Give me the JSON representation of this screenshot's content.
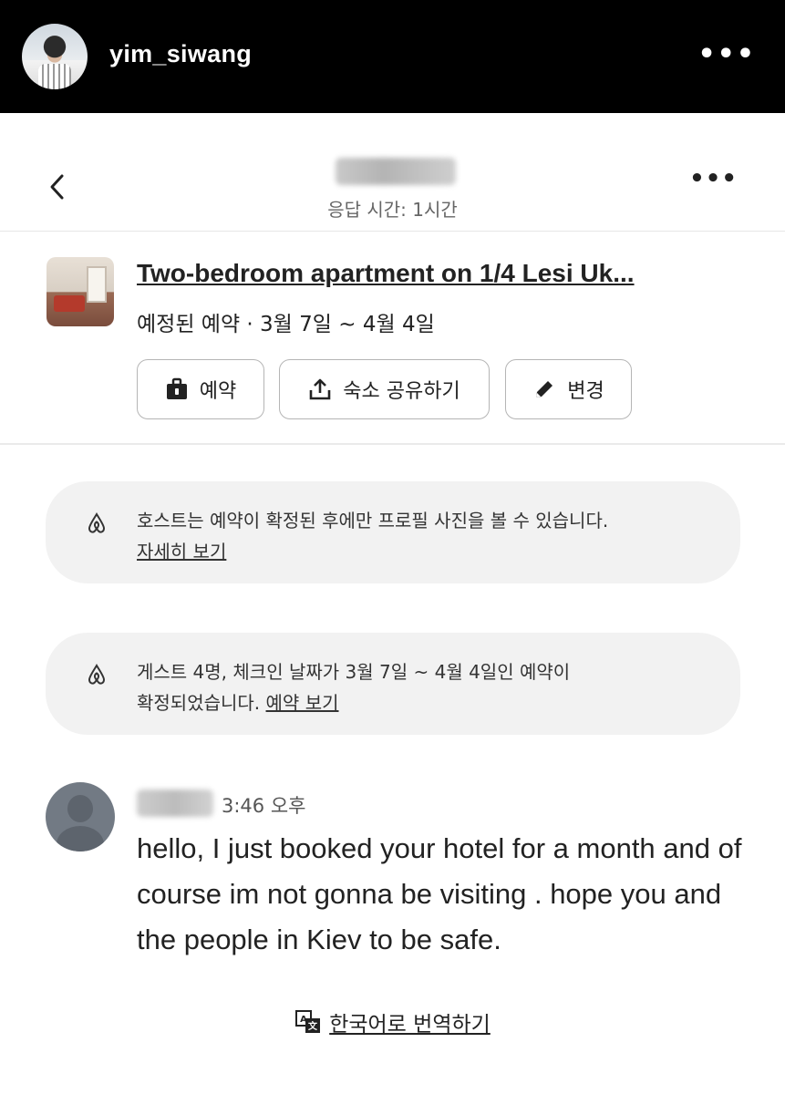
{
  "instagram": {
    "username": "yim_siwang",
    "more_label": "•••"
  },
  "header": {
    "response_time": "응답 시간: 1시간",
    "more_label": "•••"
  },
  "listing": {
    "title": "Two-bedroom apartment on 1/4 Lesi Uk...",
    "subtitle": "예정된 예약 · 3월 7일 ~ 4월 4일",
    "buttons": {
      "reserve": "예약",
      "share": "숙소 공유하기",
      "edit": "변경"
    }
  },
  "notices": [
    {
      "text": "호스트는 예약이 확정된 후에만 프로필 사진을 볼 수 있습니다.",
      "link": "자세히 보기"
    },
    {
      "text_line1": "게스트 4명, 체크인 날짜가 3월 7일 ~ 4월 4일인 예약이",
      "text_line2": "확정되었습니다.",
      "link": "예약 보기"
    }
  ],
  "message": {
    "time": "3:46 오후",
    "text": "hello, I just booked your hotel for a month and of course im not gonna be visiting . hope you and the people in Kiev to be safe."
  },
  "translate": {
    "label": "한국어로 번역하기"
  }
}
